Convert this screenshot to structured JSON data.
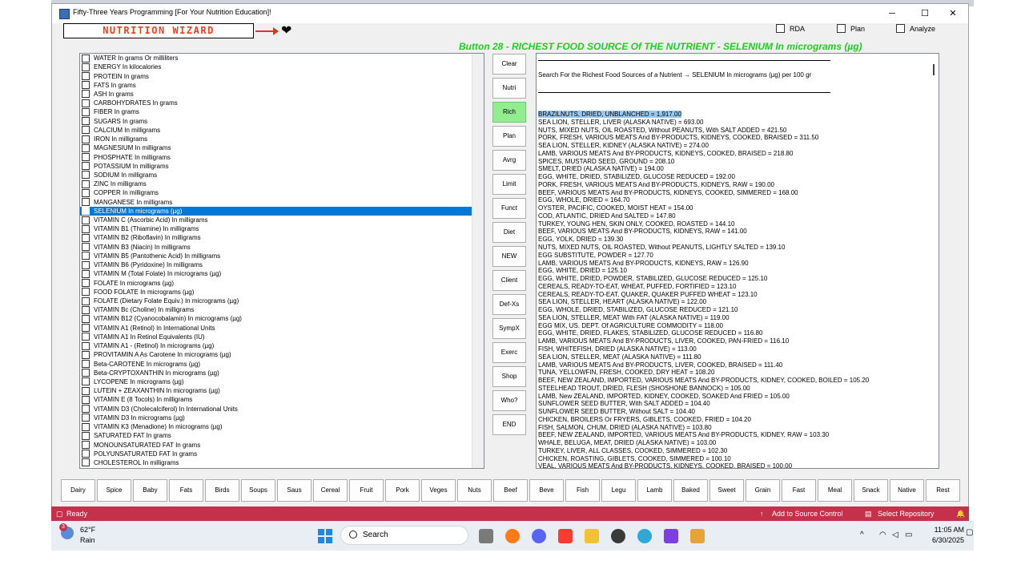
{
  "window": {
    "title": "Fifty-Three Years Programming [For Your Nutrition Education]!",
    "minimize": "─",
    "maximize": "☐",
    "close": "✕"
  },
  "logo": {
    "text": "NUTRITION WIZARD",
    "heart": "❤"
  },
  "options": {
    "rda": "RDA",
    "plan": "Plan",
    "analyze": "Analyze"
  },
  "heading": "Button 28 - RICHEST FOOD SOURCE Of THE NUTRIENT - SELENIUM In micrograms (µg)",
  "nutrients": [
    "WATER In grams Or milliliters",
    "ENERGY In kilocalories",
    "PROTEIN In grams",
    "FATS In grams",
    "ASH In grams",
    "CARBOHYDRATES In grams",
    "FIBER In grams",
    "SUGARS In grams",
    "CALCIUM In milligrams",
    "IRON In milligrams",
    "MAGNESIUM In milligrams",
    "PHOSPHATE In milligrams",
    "POTASSIUM In milligrams",
    "SODIUM In milligrams",
    "ZINC In milligrams",
    "COPPER In milligrams",
    "MANGANESE In milligrams",
    "SELENIUM In micrograms (µg)",
    "VITAMIN C (Ascorbic Acid) In milligrams",
    "VITAMIN B1 (Thiamine) In milligrams",
    "VITAMIN B2 (Riboflavin) In milligrams",
    "VITAMIN B3 (Niacin) In milligrams",
    "VITAMIN B5 (Pantothenic Acid) In milligrams",
    "VITAMIN B6 (Pyridoxine) In milligrams",
    "VITAMIN M (Total Folate) In micrograms (µg)",
    "FOLATE In micrograms (µg)",
    "FOOD FOLATE In micrograms (µg)",
    "FOLATE (Dietary Folate Equiv.) In micrograms (µg)",
    "VITAMIN Bc (Choline) In milligrams",
    "VITAMIN B12 (Cyanocobalamin) In micrograms (µg)",
    "VITAMIN A1 (Retinol) In International Units",
    "VITAMIN A1 In Retinol Equivalents (IU)",
    "VITAMIN A1 - (Retinol) In micrograms (µg)",
    "PROVITAMIN A As Carotene In micrograms (µg)",
    "Beta-CAROTENE In micrograms (µg)",
    "Beta-CRYPTOXANTHIN In micrograms (µg)",
    "LYCOPENE In micrograms (µg)",
    "LUTEIN + ZEAXANTHIN In micrograms (µg)",
    "VITAMIN E (8 Tocols) In milligrams",
    "VITAMIN D3 (Cholecalciferol) In International Units",
    "VITAMIN D3 In micrograms (µg)",
    "VITAMIN K3 (Menadione) In micrograms (µg)",
    "SATURATED FAT In grams",
    "MONOUNSATURATED FAT In grams",
    "POLYUNSATURATED FAT In grams",
    "CHOLESTEROL In milligrams"
  ],
  "selected_index": 17,
  "side_buttons": [
    "Clear",
    "Nutri",
    "Rich",
    "Plan",
    "Avrg",
    "Limit",
    "Funct",
    "Diet",
    "NEW",
    "Client",
    "Def-Xs",
    "SympX",
    "Exerc",
    "Shop",
    "Who?",
    "END"
  ],
  "active_side_button": "Rich",
  "output": {
    "search_line": "Search For the Richest Food Sources of a Nutrient → SELENIUM In micrograms (µg) per 100 gr",
    "results": [
      "BRAZILNUTS, DRIED, UNBLANCHED = 1,917.00",
      "SEA LION, STELLER, LIVER (ALASKA NATIVE) = 693.00",
      "NUTS, MIXED NUTS, OIL ROASTED, Without PEANUTS, With SALT ADDED = 421.50",
      "PORK, FRESH, VARIOUS MEATS And BY-PRODUCTS, KIDNEYS, COOKED, BRAISED = 311.50",
      "SEA LION, STELLER, KIDNEY (ALASKA NATIVE) = 274.00",
      "LAMB, VARIOUS MEATS And BY-PRODUCTS, KIDNEYS, COOKED, BRAISED = 218.80",
      "SPICES, MUSTARD SEED, GROUND = 208.10",
      "SMELT, DRIED (ALASKA NATIVE) = 194.00",
      "EGG, WHITE, DRIED, STABILIZED, GLUCOSE REDUCED = 192.00",
      "PORK, FRESH, VARIOUS MEATS And BY-PRODUCTS, KIDNEYS, RAW = 190.00",
      "BEEF, VARIOUS MEATS And BY-PRODUCTS, KIDNEYS, COOKED, SIMMERED = 168.00",
      "EGG, WHOLE, DRIED = 164.70",
      "OYSTER, PACIFIC, COOKED, MOIST HEAT = 154.00",
      "COD, ATLANTIC, DRIED And SALTED = 147.80",
      "TURKEY, YOUNG HEN, SKIN ONLY, COOKED, ROASTED = 144.10",
      "BEEF, VARIOUS MEATS And BY-PRODUCTS, KIDNEYS, RAW = 141.00",
      "EGG, YOLK, DRIED = 139.30",
      "NUTS, MIXED NUTS, OIL ROASTED, Without PEANUTS, LIGHTLY SALTED = 139.10",
      "EGG SUBSTITUTE, POWDER = 127.70",
      "LAMB, VARIOUS MEATS And BY-PRODUCTS, KIDNEYS, RAW = 126.90",
      "EGG, WHITE, DRIED = 125.10",
      "EGG, WHITE, DRIED, POWDER, STABILIZED, GLUCOSE REDUCED = 125.10",
      "CEREALS, READY-TO-EAT, WHEAT, PUFFED, FORTIFIED = 123.10",
      "CEREALS, READY-TO-EAT, QUAKER, QUAKER PUFFED WHEAT = 123.10",
      "SEA LION, STELLER, HEART (ALASKA NATIVE) = 122.00",
      "EGG, WHOLE, DRIED, STABILIZED, GLUCOSE REDUCED = 121.10",
      "SEA LION, STELLER, MEAT With FAT (ALASKA NATIVE) = 119.00",
      "EGG MIX, US. DEPT. Of AGRICULTURE COMMODITY = 118.00",
      "EGG, WHITE, DRIED, FLAKES, STABILIZED, GLUCOSE REDUCED = 116.80",
      "LAMB, VARIOUS MEATS And BY-PRODUCTS, LIVER, COOKED, PAN-FRIED = 116.10",
      "FISH, WHITEFISH, DRIED (ALASKA NATIVE) = 113.00",
      "SEA LION, STELLER, MEAT (ALASKA NATIVE) = 111.80",
      "LAMB, VARIOUS MEATS And BY-PRODUCTS, LIVER, COOKED, BRAISED = 111.40",
      "TUNA, YELLOWFIN, FRESH, COOKED, DRY HEAT = 108.20",
      "BEEF, NEW ZEALAND, IMPORTED, VARIOUS MEATS And BY-PRODUCTS, KIDNEY, COOKED, BOILED = 105.20",
      "STEELHEAD TROUT, DRIED, FLESH (SHOSHONE BANNOCK) = 105.00",
      "LAMB, New ZEALAND, IMPORTED, KIDNEY, COOKED, SOAKED And FRIED = 105.00",
      "SUNFLOWER SEED BUTTER, With SALT ADDED = 104.40",
      "SUNFLOWER SEED BUTTER, Without SALT = 104.40",
      "CHICKEN, BROILERS Or FRYERS, GIBLETS, COOKED, FRIED = 104.20",
      "FISH, SALMON, CHUM, DRIED (ALASKA NATIVE) = 103.80",
      "BEEF, NEW ZEALAND, IMPORTED, VARIOUS MEATS And BY-PRODUCTS, KIDNEY, RAW = 103.30",
      "WHALE, BELUGA, MEAT, DRIED (ALASKA NATIVE) = 103.00",
      "TURKEY, LIVER, ALL CLASSES, COOKED, SIMMERED = 102.30",
      "CHICKEN, ROASTING, GIBLETS, COOKED, SIMMERED = 100.10",
      "VEAL, VARIOUS MEATS And BY-PRODUCTS, KIDNEYS, COOKED, BRAISED = 100.00"
    ]
  },
  "categories": [
    "Dairy",
    "Spice",
    "Baby",
    "Fats",
    "Birds",
    "Soups",
    "Saus",
    "Cereal",
    "Fruit",
    "Pork",
    "Veges",
    "Nuts",
    "Beef",
    "Beve",
    "Fish",
    "Legu",
    "Lamb",
    "Baked",
    "Sweet",
    "Grain",
    "Fast",
    "Meal",
    "Snack",
    "Native",
    "Rest"
  ],
  "statusbar": {
    "ready": "Ready",
    "source_control": "Add to Source Control",
    "repository": "Select Repository"
  },
  "taskbar": {
    "badge": "3",
    "temperature": "62°F",
    "weather": "Rain",
    "search": "Search",
    "time": "11:05 AM",
    "date": "6/30/2025"
  },
  "colors": {
    "accent": "#0078d7",
    "heading": "#22cc22",
    "logo": "#f23d1e",
    "status": "#c4314b",
    "active_button": "#90ee90"
  }
}
